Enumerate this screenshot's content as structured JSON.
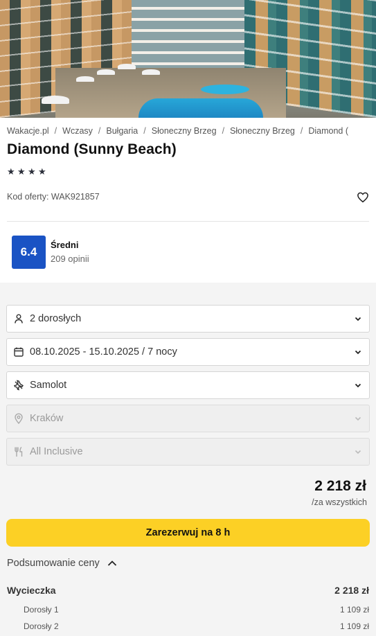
{
  "breadcrumb": {
    "items": [
      "Wakacje.pl",
      "Wczasy",
      "Bułgaria",
      "Słoneczny Brzeg",
      "Słoneczny Brzeg",
      "Diamond ("
    ]
  },
  "hotel": {
    "name": "Diamond (Sunny Beach)",
    "stars": 4,
    "offer_code": "Kod oferty: WAK921857"
  },
  "rating": {
    "score": "6.4",
    "label": "Średni",
    "reviews": "209 opinii"
  },
  "form": {
    "travelers": {
      "value": "2 dorosłych",
      "icon": "person-icon"
    },
    "dates": {
      "value": "08.10.2025 - 15.10.2025 / 7 nocy",
      "icon": "calendar-icon"
    },
    "transport": {
      "value": "Samolot",
      "icon": "plane-icon"
    },
    "departure": {
      "value": "Kraków",
      "icon": "location-pin-icon"
    },
    "board": {
      "value": "All Inclusive",
      "icon": "cutlery-icon"
    }
  },
  "price": {
    "total": "2 218 zł",
    "note": "/za wszystkich"
  },
  "book_button": "Zarezerwuj na 8 h",
  "summary": {
    "toggle_label": "Podsumowanie ceny",
    "trip_label": "Wycieczka",
    "trip_total": "2 218 zł",
    "rows": [
      {
        "label": "Dorosły 1",
        "price": "1 109 zł"
      },
      {
        "label": "Dorosły 2",
        "price": "1 109 zł"
      }
    ]
  },
  "colors": {
    "accent_yellow": "#fcd025",
    "rating_blue": "#1a53c4",
    "panel_gray": "#f4f4f4"
  }
}
